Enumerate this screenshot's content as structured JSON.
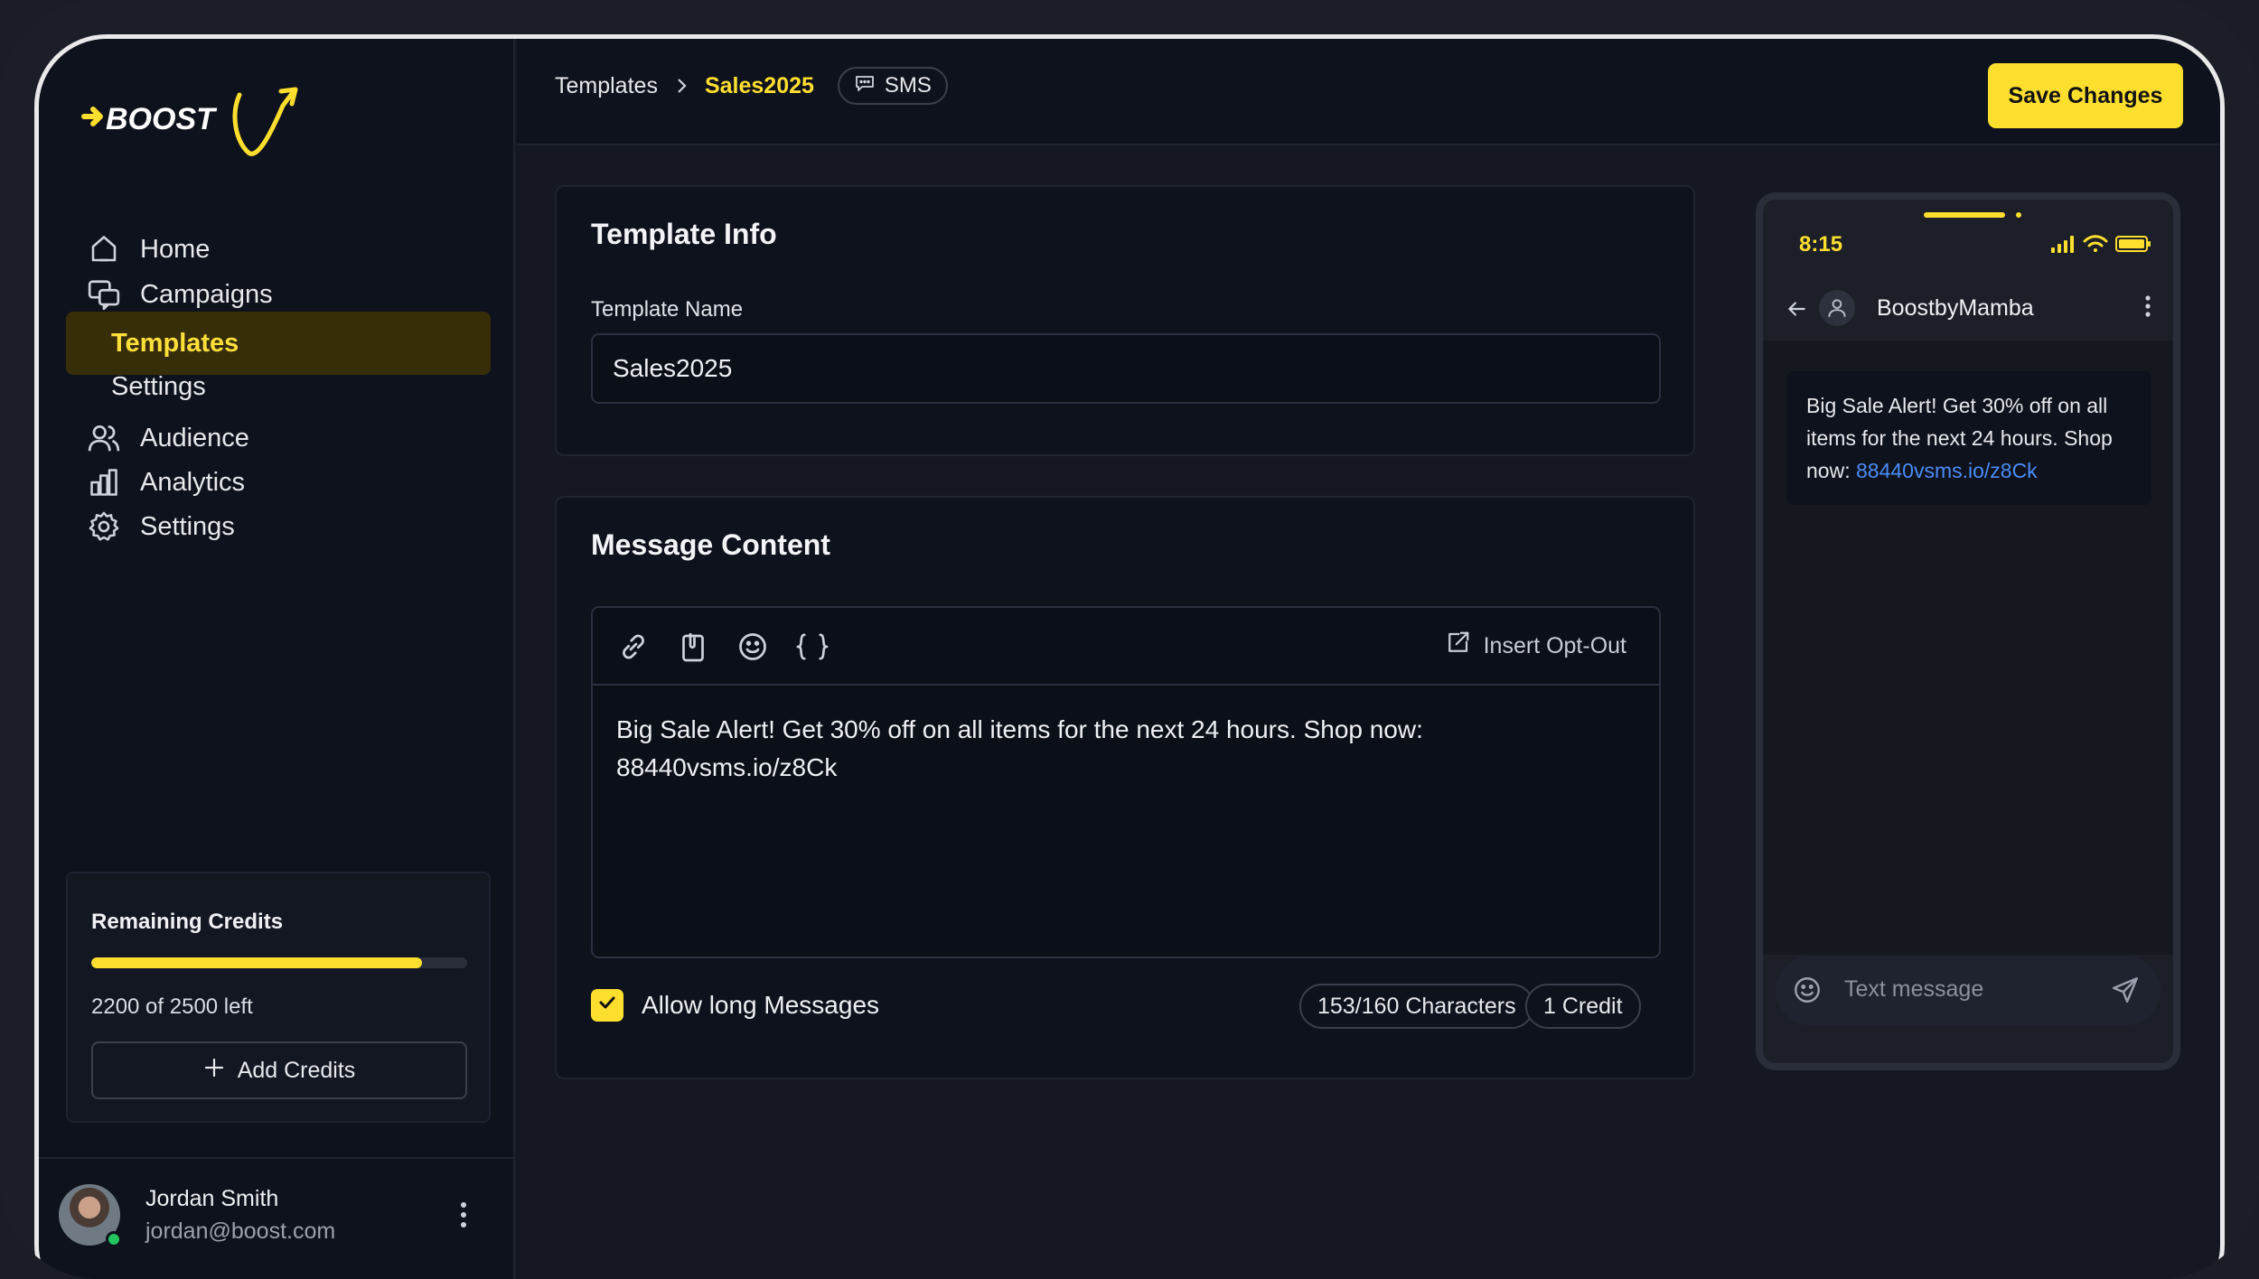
{
  "brand": {
    "logo_text": "BOOST"
  },
  "sidebar": {
    "nav": [
      {
        "id": "home",
        "label": "Home",
        "icon": "home-icon"
      },
      {
        "id": "campaigns",
        "label": "Campaigns",
        "icon": "chat-bubbles-icon"
      },
      {
        "id": "templates",
        "label": "Templates",
        "active": true
      },
      {
        "id": "settings-sub",
        "label": "Settings"
      },
      {
        "id": "audience",
        "label": "Audience",
        "icon": "users-icon"
      },
      {
        "id": "analytics",
        "label": "Analytics",
        "icon": "bar-chart-icon"
      },
      {
        "id": "settings",
        "label": "Settings",
        "icon": "gear-icon"
      }
    ],
    "credits": {
      "title": "Remaining Credits",
      "used_fraction": 0.88,
      "remaining_text": "2200 of 2500 left",
      "add_label": "Add Credits"
    },
    "user": {
      "name": "Jordan Smith",
      "email": "jordan@boost.com",
      "online": true
    }
  },
  "header": {
    "breadcrumbs": [
      "Templates",
      "Sales2025"
    ],
    "channel_pill": "SMS",
    "save_label": "Save Changes"
  },
  "template_info": {
    "title": "Template Info",
    "name_label": "Template Name",
    "name_value": "Sales2025"
  },
  "message_content": {
    "title": "Message Content",
    "toolbar_tools": [
      "link-icon",
      "attachment-icon",
      "emoji-icon",
      "variable-braces-icon"
    ],
    "insert_optout_label": "Insert Opt-Out",
    "body_text": "Big Sale Alert! Get 30% off on all items for the next 24 hours. Shop now: 88440vsms.io/z8Ck",
    "allow_long_label": "Allow long Messages",
    "allow_long_checked": true,
    "char_count": "153/160 Characters",
    "credit_count": "1 Credit"
  },
  "preview": {
    "time": "8:15",
    "contact": "BoostbyMamba",
    "message_prefix": "Big Sale Alert! Get 30% off on all items for the next 24 hours. Shop now: ",
    "message_link": "88440vsms.io/z8Ck",
    "composer_placeholder": "Text message"
  },
  "colors": {
    "accent": "#ffdf2e",
    "background": "#0e121c",
    "link": "#4a8cf7"
  }
}
